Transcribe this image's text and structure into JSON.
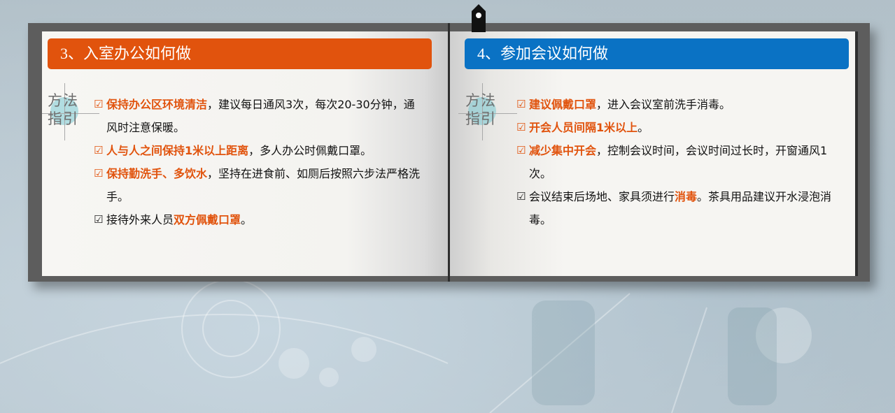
{
  "left_page": {
    "header": "3、入室办公如何做",
    "guide_label_line1": "方法",
    "guide_label_line2": "指引",
    "items": [
      {
        "check": "☑",
        "highlight": "保持办公区环境清洁",
        "text": "，建议每日通风3次，每次20-30分钟，通风时注意保暖。",
        "check_highlight": true
      },
      {
        "check": "☑",
        "highlight": "人与人之间保持1米以上距离",
        "text": "，多人办公时佩戴口罩。",
        "check_highlight": true
      },
      {
        "check": "☑",
        "highlight": "保持勤洗手、多饮水",
        "text": "，坚持在进食前、如厕后按照六步法严格洗手。",
        "check_highlight": true
      },
      {
        "check": "☑",
        "pre": "接待外来人员",
        "highlight": "双方佩戴口罩",
        "text": "。",
        "check_highlight": false
      }
    ]
  },
  "right_page": {
    "header": "4、参加会议如何做",
    "guide_label_line1": "方法",
    "guide_label_line2": "指引",
    "items": [
      {
        "check": "☑",
        "highlight": "建议佩戴口罩",
        "text": "，进入会议室前洗手消毒。",
        "check_highlight": true
      },
      {
        "check": "☑",
        "highlight": "开会人员间隔1米以上",
        "text": "。",
        "check_highlight": true
      },
      {
        "check": "☑",
        "highlight": "减少集中开会",
        "text": "，控制会议时间，会议时间过长时，开窗通风1次。",
        "check_highlight": true
      },
      {
        "check": "☑",
        "pre": "会议结束后场地、家具须进行",
        "highlight": "消毒",
        "text": "。茶具用品建议开水浸泡消毒。",
        "check_highlight": false
      }
    ]
  },
  "colors": {
    "left_header": "#e1530d",
    "right_header": "#0a72c4",
    "highlight": "#e1530d"
  }
}
